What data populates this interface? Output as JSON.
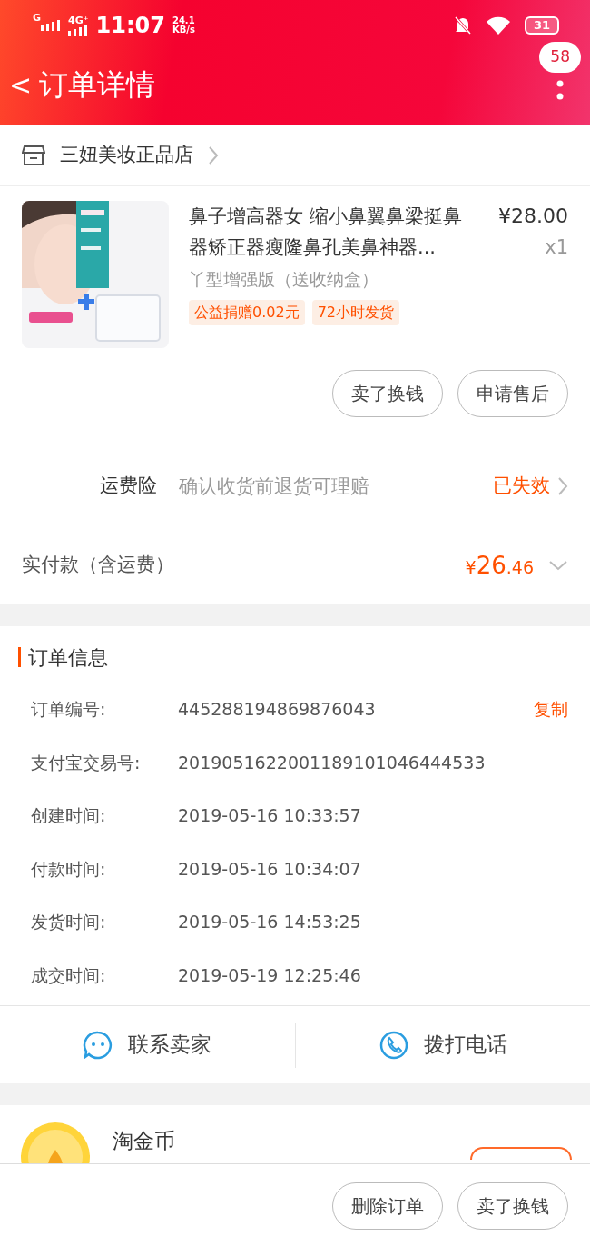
{
  "status_bar": {
    "network": "G",
    "network_type": "4G⁺",
    "time": "11:07",
    "speed": "24.1",
    "speed_unit": "KB/s",
    "battery": "31"
  },
  "header": {
    "back": "<",
    "title": "订单详情",
    "badge": "58"
  },
  "store": {
    "name": "三妞美妆正品店"
  },
  "product": {
    "title": "鼻子增高器女 缩小鼻翼鼻梁挺鼻器矫正器瘦隆鼻孔美鼻神器...",
    "price": "¥28.00",
    "quantity": "x1",
    "variant": "丫型增强版（送收纳盒）",
    "tags": [
      "公益捐赠0.02元",
      "72小时发货"
    ]
  },
  "product_actions": [
    "卖了换钱",
    "申请售后"
  ],
  "insurance": {
    "label": "运费险",
    "description": "确认收货前退货可理赔",
    "status": "已失效"
  },
  "payment": {
    "label": "实付款（含运费）",
    "currency": "¥",
    "amount": "26",
    "decimals": ".46"
  },
  "order_info": {
    "title": "订单信息",
    "copy": "复制",
    "rows": [
      {
        "label": "订单编号:",
        "value": "445288194869876043"
      },
      {
        "label": "支付宝交易号:",
        "value": "2019051622001189101046444533"
      },
      {
        "label": "创建时间:",
        "value": "2019-05-16 10:33:57"
      },
      {
        "label": "付款时间:",
        "value": "2019-05-16 10:34:07"
      },
      {
        "label": "发货时间:",
        "value": "2019-05-16 14:53:25"
      },
      {
        "label": "成交时间:",
        "value": "2019-05-19 12:25:46"
      }
    ]
  },
  "contact": [
    {
      "kind": "chat",
      "label": "联系卖家"
    },
    {
      "kind": "phone",
      "label": "拨打电话"
    }
  ],
  "coins": {
    "title": "淘金币"
  },
  "bottom_actions": [
    "删除订单",
    "卖了换钱"
  ]
}
